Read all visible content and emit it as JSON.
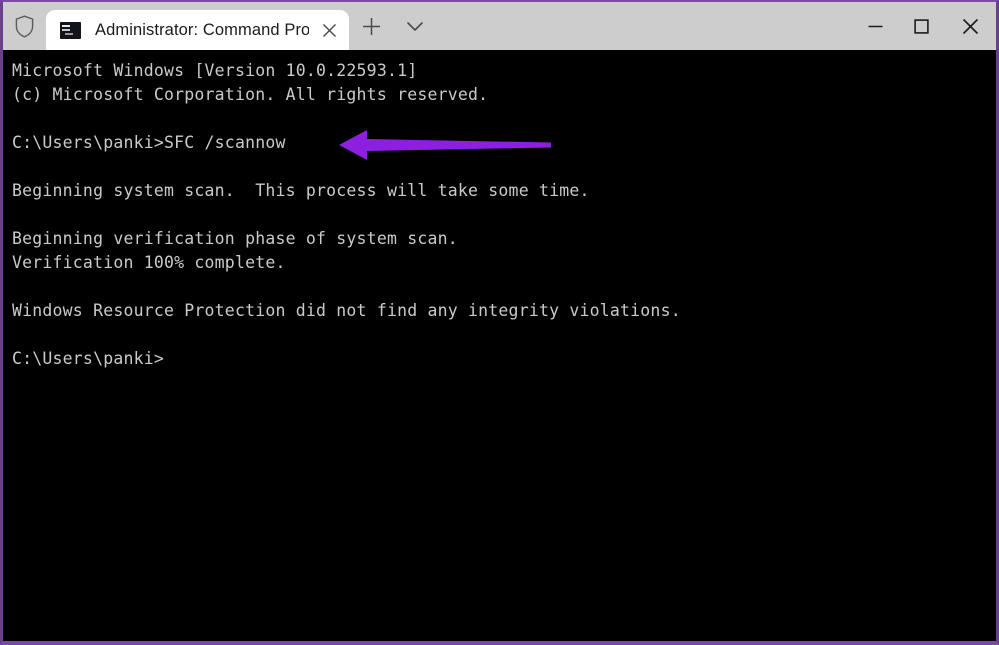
{
  "window": {
    "border_color": "#7d4aa3",
    "titlebar_bg": "#cdcdcd",
    "terminal_bg": "#000000",
    "terminal_fg": "#ccc9cc"
  },
  "titlebar": {
    "shield_icon": "shield-icon",
    "tab": {
      "icon": "command-prompt-icon",
      "title": "Administrator: Command Prom",
      "close_label": "×"
    },
    "new_tab_label": "+",
    "dropdown_label": "⌄",
    "minimize_label": "–",
    "maximize_label": "□",
    "close_label": "×"
  },
  "terminal": {
    "lines": [
      "Microsoft Windows [Version 10.0.22593.1]",
      "(c) Microsoft Corporation. All rights reserved.",
      "",
      "C:\\Users\\panki>SFC /scannow",
      "",
      "Beginning system scan.  This process will take some time.",
      "",
      "Beginning verification phase of system scan.",
      "Verification 100% complete.",
      "",
      "Windows Resource Protection did not find any integrity violations.",
      "",
      "C:\\Users\\panki>"
    ]
  },
  "annotation": {
    "arrow_color": "#8c1fe0",
    "arrow_direction": "left",
    "points_at": "SFC /scannow"
  }
}
